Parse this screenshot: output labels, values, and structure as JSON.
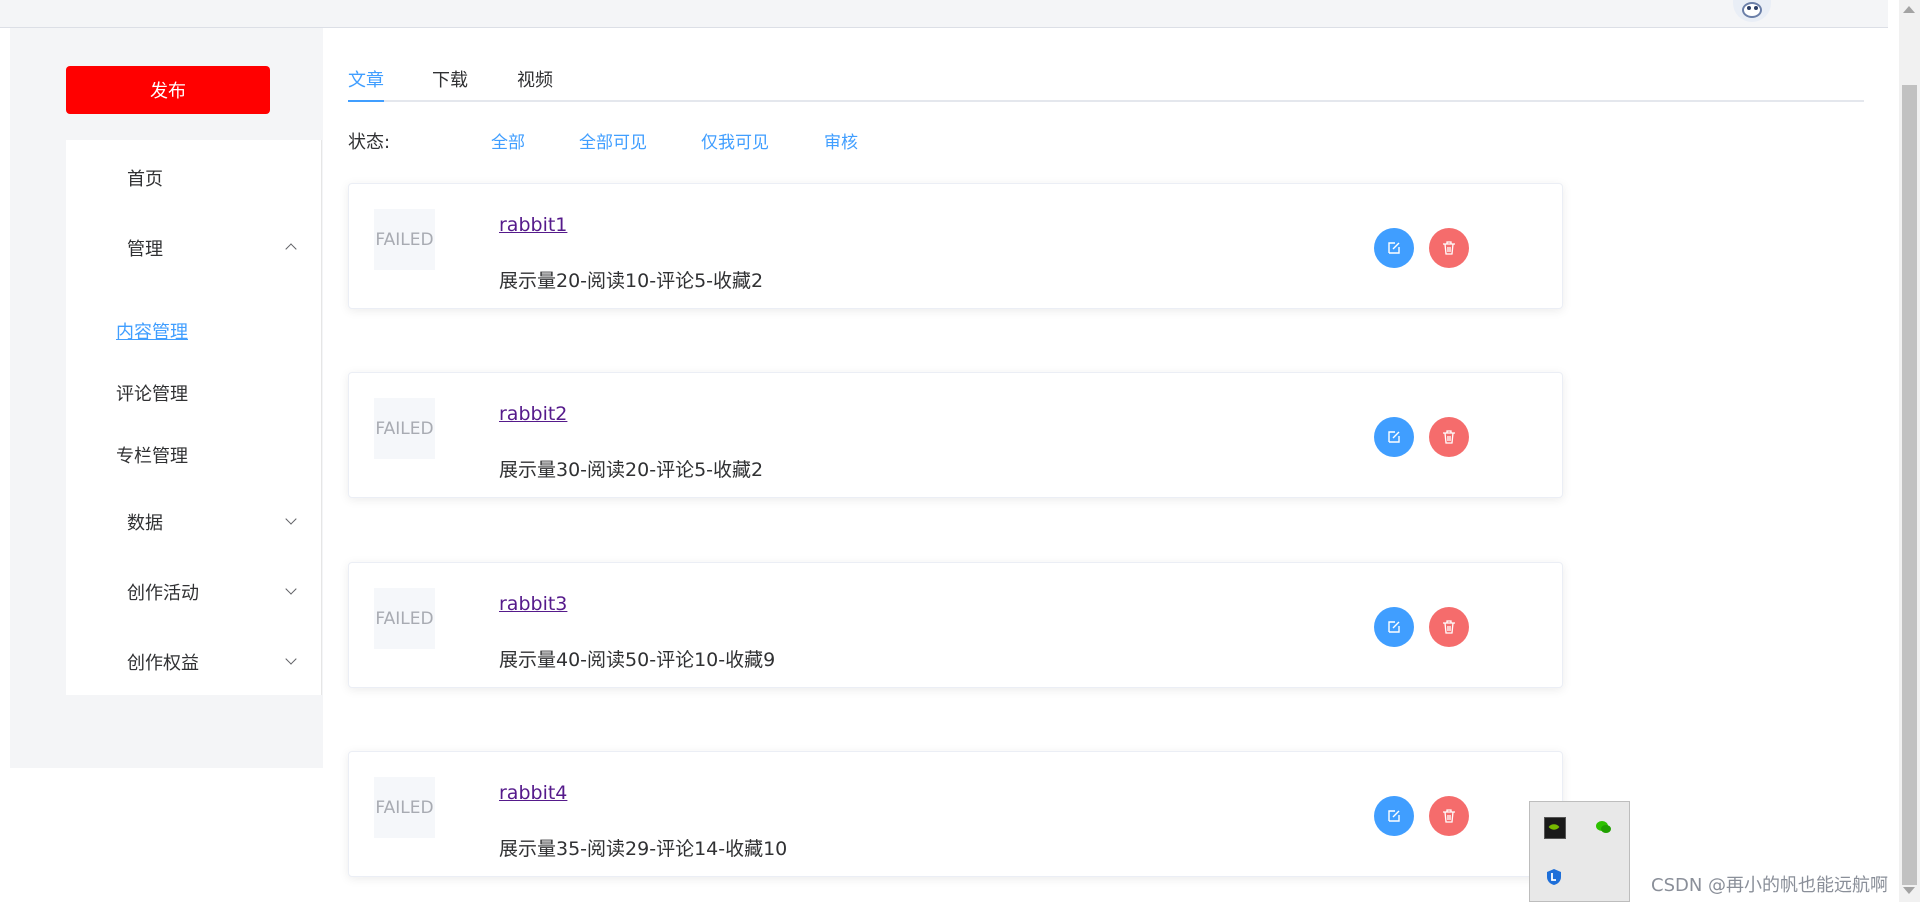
{
  "header": {
    "avatar_alt": "user avatar"
  },
  "sidebar": {
    "publish_label": "发布",
    "menu": {
      "home": "首页",
      "manage": "管理",
      "content_manage": "内容管理",
      "comment_manage": "评论管理",
      "column_manage": "专栏管理",
      "data": "数据",
      "creative_activity": "创作活动",
      "creative_rights": "创作权益"
    }
  },
  "tabs": [
    "文章",
    "下载",
    "视频"
  ],
  "status_filter": {
    "label": "状态:",
    "options": [
      "全部",
      "全部可见",
      "仅我可见",
      "审核"
    ]
  },
  "articles": [
    {
      "thumb": "FAILED",
      "title": "rabbit1",
      "stats": "展示量20-阅读10-评论5-收藏2"
    },
    {
      "thumb": "FAILED",
      "title": "rabbit2",
      "stats": "展示量30-阅读20-评论5-收藏2"
    },
    {
      "thumb": "FAILED",
      "title": "rabbit3",
      "stats": "展示量40-阅读50-评论10-收藏9"
    },
    {
      "thumb": "FAILED",
      "title": "rabbit4",
      "stats": "展示量35-阅读29-评论14-收藏10"
    }
  ],
  "watermark": "CSDN @再小的帆也能远航啊",
  "colors": {
    "publish": "#ff0000",
    "primary": "#409eff",
    "danger": "#f56c6c"
  }
}
